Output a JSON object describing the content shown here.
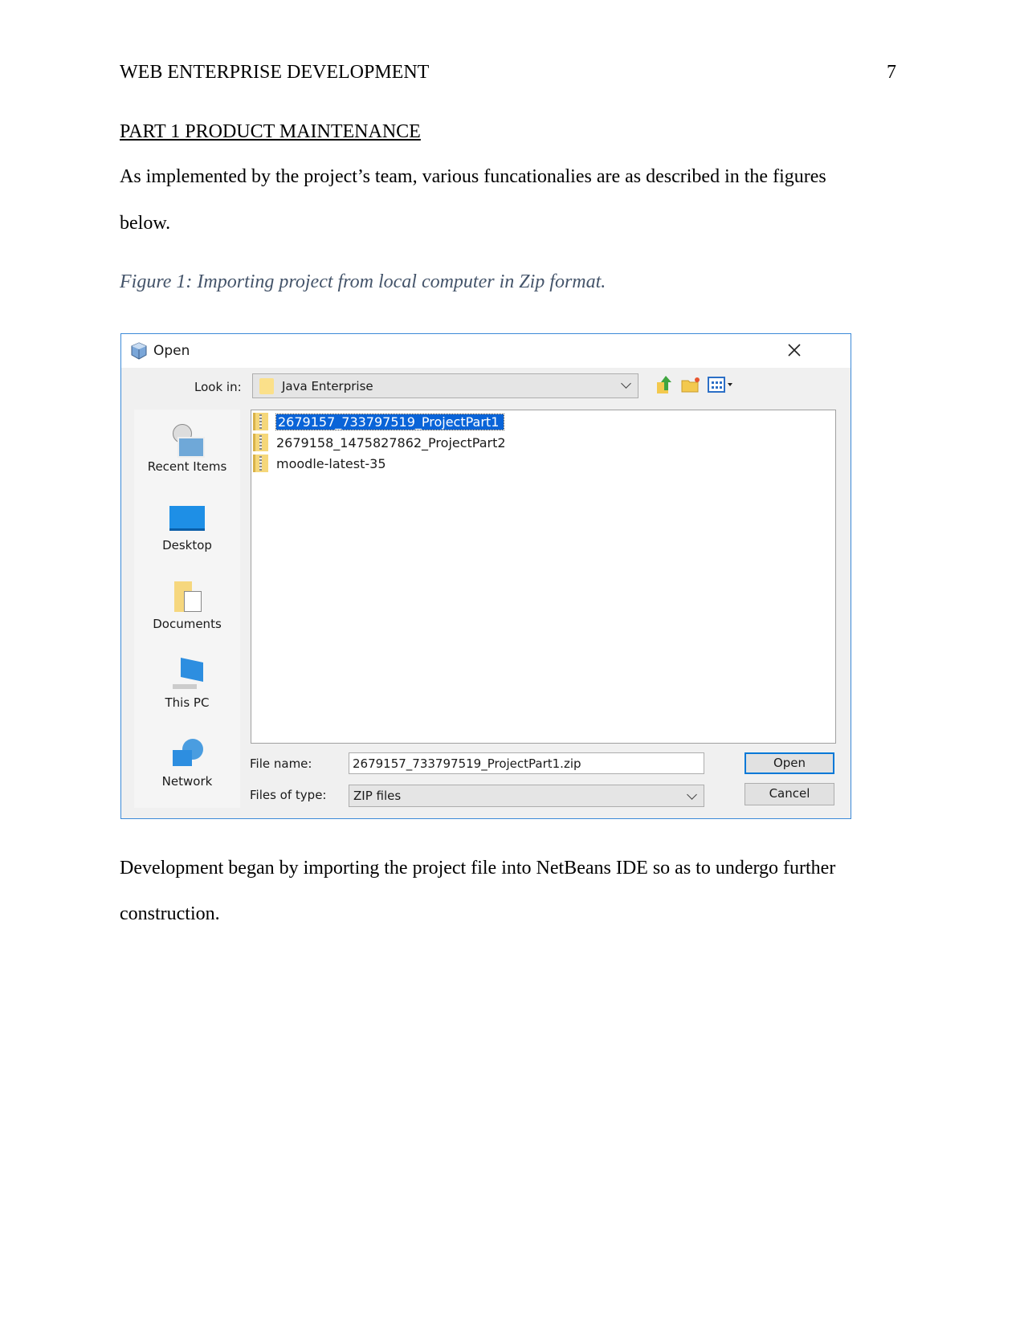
{
  "header": {
    "running_title": "WEB ENTERPRISE DEVELOPMENT",
    "page_number": "7"
  },
  "section_heading": "PART 1 PRODUCT MAINTENANCE",
  "intro": {
    "line1": "As implemented by the project’s team, various funcationalies are as described in the figures",
    "line2": "below."
  },
  "figure_caption": "Figure 1: Importing project from local computer in Zip format.",
  "dialog": {
    "title": "Open",
    "look_in_label": "Look in:",
    "look_in_value": "Java Enterprise",
    "toolbar_icons": [
      "up-folder-icon",
      "new-folder-icon",
      "view-menu-icon"
    ],
    "places": [
      {
        "label": "Recent Items",
        "icon": "recent-items-icon"
      },
      {
        "label": "Desktop",
        "icon": "desktop-icon"
      },
      {
        "label": "Documents",
        "icon": "documents-icon"
      },
      {
        "label": "This PC",
        "icon": "this-pc-icon"
      },
      {
        "label": "Network",
        "icon": "network-icon"
      }
    ],
    "files": [
      {
        "name": "2679157_733797519_ProjectPart1",
        "selected": true
      },
      {
        "name": "2679158_1475827862_ProjectPart2",
        "selected": false
      },
      {
        "name": "moodle-latest-35",
        "selected": false
      }
    ],
    "file_name_label": "File name:",
    "file_name_value": "2679157_733797519_ProjectPart1.zip",
    "file_type_label": "Files of type:",
    "file_type_value": "ZIP files",
    "open_label": "Open",
    "cancel_label": "Cancel",
    "accent_color": "#0078d7",
    "selection_color": "#0a64d8"
  },
  "outro": {
    "line1": "Development began by importing the project file into NetBeans IDE so as to undergo further",
    "line2": "construction."
  }
}
